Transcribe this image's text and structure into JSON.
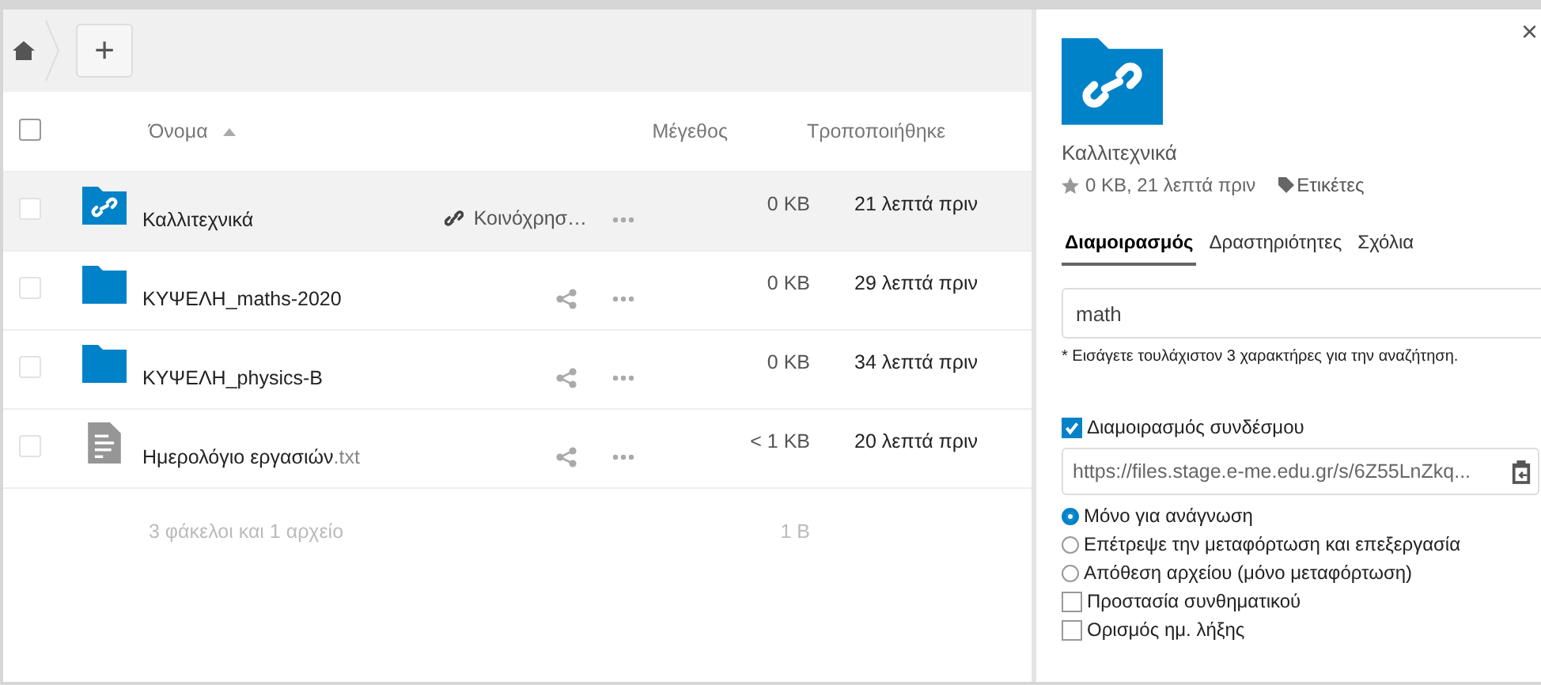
{
  "toolbar": {
    "add_button": "+"
  },
  "table": {
    "select_all_checked": false,
    "columns": [
      {
        "label": "Όνομα",
        "sorted": true
      },
      {
        "label": "Μέγεθος",
        "sorted": false
      },
      {
        "label": "Τροποποιήθηκε",
        "sorted": false
      }
    ],
    "rows": [
      {
        "kind": "shared-folder",
        "name": "Καλλιτεχνικά",
        "extension": "",
        "share_label": "Κοινόχρησ…",
        "size": "0 KB",
        "modified": "21 λεπτά πριν",
        "selected": true,
        "checked": false
      },
      {
        "kind": "folder",
        "name": "ΚΥΨΕΛΗ_maths-2020",
        "extension": "",
        "share_label": "",
        "size": "0 KB",
        "modified": "29 λεπτά πριν",
        "selected": false,
        "checked": false
      },
      {
        "kind": "folder",
        "name": "ΚΥΨΕΛΗ_physics-B",
        "extension": "",
        "share_label": "",
        "size": "0 KB",
        "modified": "34 λεπτά πριν",
        "selected": false,
        "checked": false
      },
      {
        "kind": "file",
        "name": "Ημερολόγιο εργασιών",
        "extension": ".txt",
        "share_label": "",
        "size": "< 1 KB",
        "modified": "20 λεπτά πριν",
        "selected": false,
        "checked": false
      }
    ],
    "summary": {
      "label": "3 φάκελοι και 1 αρχείο",
      "size": "1 B"
    }
  },
  "details": {
    "close": "×",
    "name": "Καλλιτεχνικά",
    "meta": "0 KB, 21 λεπτά πριν",
    "tags": "Ετικέτες",
    "tabs": [
      {
        "label": "Διαμοιρασμός",
        "selected": true
      },
      {
        "label": "Δραστηριότητες",
        "selected": false
      },
      {
        "label": "Σχόλια",
        "selected": false
      }
    ],
    "search": {
      "value": "math"
    },
    "hint": "* Εισάγετε τουλάχιστον 3 χαρακτήρες για την αναζήτηση.",
    "link_share": {
      "label": "Διαμοιρασμός συνδέσμου",
      "checked": true
    },
    "link_url": "https://files.stage.e-me.edu.gr/s/6Z55LnZkq...",
    "options": [
      {
        "kind": "radio",
        "label": "Μόνο για ανάγνωση",
        "selected": true
      },
      {
        "kind": "radio",
        "label": "Επέτρεψε την μεταφόρτωση και επεξεργασία",
        "selected": false
      },
      {
        "kind": "radio",
        "label": "Απόθεση αρχείου (μόνο μεταφόρτωση)",
        "selected": false
      },
      {
        "kind": "checkbox",
        "label": "Προστασία συνθηματικού",
        "checked": false
      },
      {
        "kind": "checkbox",
        "label": "Ορισμός ημ. λήξης",
        "checked": false
      }
    ]
  }
}
